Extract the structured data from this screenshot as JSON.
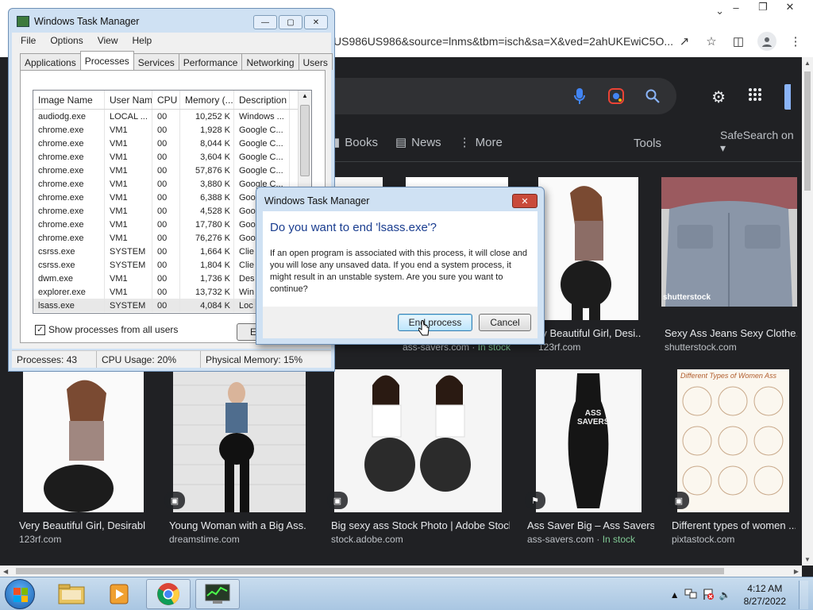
{
  "browser": {
    "address_text": "US986US986&source=lnms&tbm=isch&sa=X&ved=2ahUKEwiC5O...",
    "nav": [
      {
        "icon": "book-icon",
        "label": "Books"
      },
      {
        "icon": "news-icon",
        "label": "News"
      },
      {
        "icon": "more-icon",
        "label": "More"
      }
    ],
    "tools_label": "Tools",
    "safesearch_label": "SafeSearch on",
    "images": [
      {
        "title": "ry Beautiful Girl, Desi...",
        "source": "123rf.com",
        "in_stock": ""
      },
      {
        "title": "Sexy Ass Jeans Sexy Clothe...",
        "source": "shutterstock.com",
        "in_stock": ""
      },
      {
        "title": "",
        "source": "ass-savers.com",
        "in_stock": "In stock"
      },
      {
        "title": "Very Beautiful Girl, Desirabl...",
        "source": "123rf.com",
        "in_stock": ""
      },
      {
        "title": "Young Woman with a Big Ass. ...",
        "source": "dreamstime.com",
        "in_stock": ""
      },
      {
        "title": "Big sexy ass Stock Photo | Adobe Stock",
        "source": "stock.adobe.com",
        "in_stock": ""
      },
      {
        "title": "Ass Saver Big – Ass Savers",
        "source": "ass-savers.com",
        "in_stock": "In stock"
      },
      {
        "title": "Different types of women ...",
        "source": "pixtastock.com",
        "in_stock": ""
      }
    ],
    "watermark_text": "shutterstock",
    "product_text": "ASS SAVERS",
    "chart_title": "Different Types of Women Ass"
  },
  "task_manager": {
    "title": "Windows Task Manager",
    "menu": [
      "File",
      "Options",
      "View",
      "Help"
    ],
    "tabs": [
      "Applications",
      "Processes",
      "Services",
      "Performance",
      "Networking",
      "Users"
    ],
    "active_tab": "Processes",
    "columns": [
      "Image Name",
      "User Name",
      "CPU",
      "Memory (...",
      "Description"
    ],
    "rows": [
      [
        "audiodg.exe",
        "LOCAL ...",
        "00",
        "10,252 K",
        "Windows ..."
      ],
      [
        "chrome.exe",
        "VM1",
        "00",
        "1,928 K",
        "Google C..."
      ],
      [
        "chrome.exe",
        "VM1",
        "00",
        "8,044 K",
        "Google C..."
      ],
      [
        "chrome.exe",
        "VM1",
        "00",
        "3,604 K",
        "Google C..."
      ],
      [
        "chrome.exe",
        "VM1",
        "00",
        "57,876 K",
        "Google C..."
      ],
      [
        "chrome.exe",
        "VM1",
        "00",
        "3,880 K",
        "Google C..."
      ],
      [
        "chrome.exe",
        "VM1",
        "00",
        "6,388 K",
        "Goo"
      ],
      [
        "chrome.exe",
        "VM1",
        "00",
        "4,528 K",
        "Goo"
      ],
      [
        "chrome.exe",
        "VM1",
        "00",
        "17,780 K",
        "Goo"
      ],
      [
        "chrome.exe",
        "VM1",
        "00",
        "76,276 K",
        "Goo"
      ],
      [
        "csrss.exe",
        "SYSTEM",
        "00",
        "1,664 K",
        "Clie"
      ],
      [
        "csrss.exe",
        "SYSTEM",
        "00",
        "1,804 K",
        "Clie"
      ],
      [
        "dwm.exe",
        "VM1",
        "00",
        "1,736 K",
        "Des"
      ],
      [
        "explorer.exe",
        "VM1",
        "00",
        "13,732 K",
        "Win"
      ],
      [
        "lsass.exe",
        "SYSTEM",
        "00",
        "4,084 K",
        "Loc"
      ]
    ],
    "selected_row": 14,
    "show_all_label": "Show processes from all users",
    "end_process_partial": "E",
    "status": {
      "processes": "Processes: 43",
      "cpu": "CPU Usage: 20%",
      "memory": "Physical Memory: 15%"
    }
  },
  "dialog": {
    "title": "Windows Task Manager",
    "question": "Do you want to end 'lsass.exe'?",
    "message": "If an open program is associated with this process, it will close and you will lose any unsaved data. If you end a system process, it might result in an unstable system. Are you sure you want to continue?",
    "end_label": "End process",
    "cancel_label": "Cancel"
  },
  "taskbar": {
    "time": "4:12 AM",
    "date": "8/27/2022"
  }
}
